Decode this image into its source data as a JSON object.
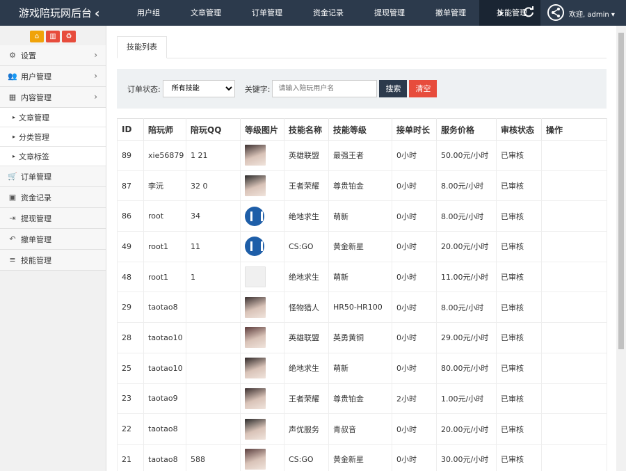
{
  "topbar": {
    "brand": "游戏陪玩网后台",
    "tabs": [
      "用户组",
      "文章管理",
      "订单管理",
      "资金记录",
      "提现管理",
      "撤单管理",
      "技能管理"
    ],
    "active_tab": 6,
    "welcome": "欢迎, admin ▾"
  },
  "sidebar": {
    "items": [
      {
        "label": "设置",
        "icon": "gear-icon",
        "chev": true
      },
      {
        "label": "用户管理",
        "icon": "users-icon",
        "chev": true
      },
      {
        "label": "内容管理",
        "icon": "grid-icon",
        "chev": true
      }
    ],
    "subitems": [
      "文章管理",
      "分类管理",
      "文章标签"
    ],
    "items2": [
      {
        "label": "订单管理",
        "icon": "cart-icon"
      },
      {
        "label": "资金记录",
        "icon": "money-icon"
      },
      {
        "label": "提现管理",
        "icon": "export-icon"
      },
      {
        "label": "撤单管理",
        "icon": "undo-icon"
      },
      {
        "label": "技能管理",
        "icon": "list-icon"
      }
    ]
  },
  "main": {
    "tab": "技能列表",
    "filter": {
      "status_label": "订单状态:",
      "status_value": "所有技能",
      "keyword_label": "关键字:",
      "keyword_placeholder": "请输入陪玩用户名",
      "search": "搜索",
      "clear": "清空"
    },
    "columns": [
      "ID",
      "陪玩师",
      "陪玩QQ",
      "等级图片",
      "技能名称",
      "技能等级",
      "接单时长",
      "服务价格",
      "审核状态",
      "操作"
    ],
    "rows": [
      {
        "id": "89",
        "player": "xie56879",
        "qq": "1        21",
        "img": "photo",
        "skill": "英雄联盟",
        "level": "最强王者",
        "hours": "0小时",
        "price": "50.00元/小时",
        "status": "已审核"
      },
      {
        "id": "87",
        "player": "李沅",
        "qq": "32        0",
        "img": "photo",
        "skill": "王者荣耀",
        "level": "尊贵铂金",
        "hours": "0小时",
        "price": "8.00元/小时",
        "status": "已审核"
      },
      {
        "id": "86",
        "player": "root",
        "qq": "34",
        "img": "logo",
        "skill": "绝地求生",
        "level": "萌新",
        "hours": "0小时",
        "price": "8.00元/小时",
        "status": "已审核"
      },
      {
        "id": "49",
        "player": "root1",
        "qq": "11",
        "img": "logo",
        "skill": "CS:GO",
        "level": "黄金新星",
        "hours": "0小时",
        "price": "20.00元/小时",
        "status": "已审核"
      },
      {
        "id": "48",
        "player": "root1",
        "qq": "1",
        "img": "blank",
        "skill": "绝地求生",
        "level": "萌新",
        "hours": "0小时",
        "price": "11.00元/小时",
        "status": "已审核"
      },
      {
        "id": "29",
        "player": "taotao8",
        "qq": "",
        "img": "photo",
        "skill": "怪物猎人",
        "level": "HR50-HR100",
        "hours": "0小时",
        "price": "8.00元/小时",
        "status": "已审核"
      },
      {
        "id": "28",
        "player": "taotao10",
        "qq": "",
        "img": "photo",
        "skill": "英雄联盟",
        "level": "英勇黄铜",
        "hours": "0小时",
        "price": "29.00元/小时",
        "status": "已审核"
      },
      {
        "id": "25",
        "player": "taotao10",
        "qq": "",
        "img": "photo",
        "skill": "绝地求生",
        "level": "萌新",
        "hours": "0小时",
        "price": "80.00元/小时",
        "status": "已审核"
      },
      {
        "id": "23",
        "player": "taotao9",
        "qq": "",
        "img": "photo",
        "skill": "王者荣耀",
        "level": "尊贵铂金",
        "hours": "2小时",
        "price": "1.00元/小时",
        "status": "已审核"
      },
      {
        "id": "22",
        "player": "taotao8",
        "qq": "",
        "img": "photo",
        "skill": "声优服务",
        "level": "青叔音",
        "hours": "0小时",
        "price": "20.00元/小时",
        "status": "已审核"
      },
      {
        "id": "21",
        "player": "taotao8",
        "qq": "588",
        "img": "photo",
        "skill": "CS:GO",
        "level": "黄金新星",
        "hours": "0小时",
        "price": "30.00元/小时",
        "status": "已审核"
      }
    ]
  },
  "colors": {
    "topbar": "#2c3a4c",
    "active_tab": "#1a2533",
    "orange": "#f0a30a",
    "red": "#e74c3c"
  }
}
